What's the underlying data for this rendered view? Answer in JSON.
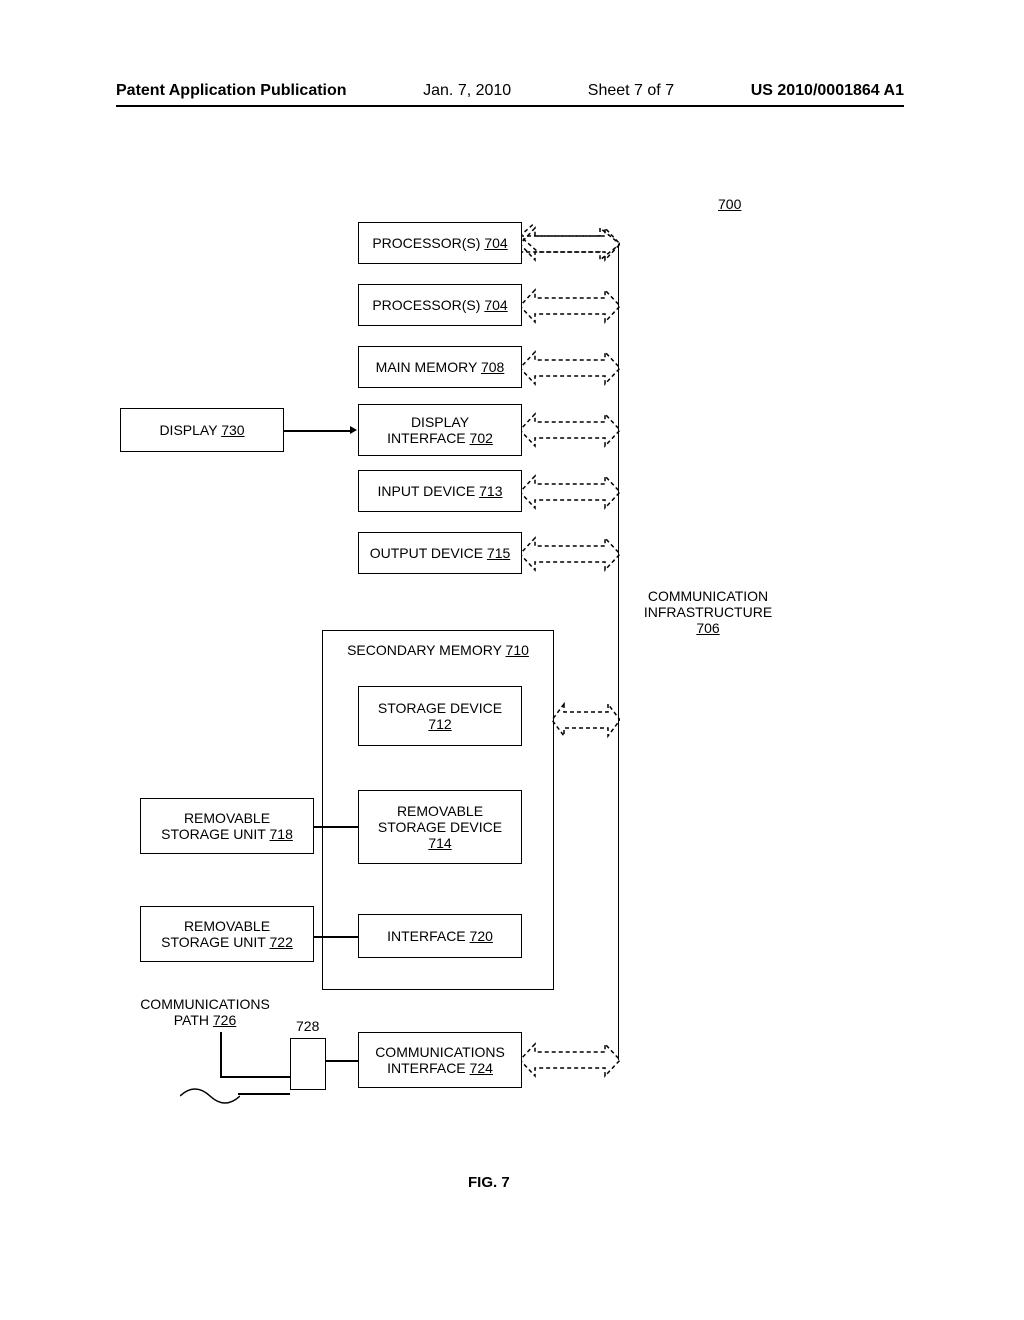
{
  "header": {
    "publication": "Patent Application Publication",
    "date": "Jan. 7, 2010",
    "sheet": "Sheet 7 of 7",
    "docnum": "US 2010/0001864 A1"
  },
  "figure": {
    "ref700": "700",
    "processor1": "PROCESSOR(S)",
    "processor1_ref": "704",
    "processor2": "PROCESSOR(S)",
    "processor2_ref": "704",
    "main_memory": "MAIN MEMORY",
    "main_memory_ref": "708",
    "display": "DISPLAY",
    "display_ref": "730",
    "display_iface": "DISPLAY INTERFACE",
    "display_iface_ref": "702",
    "input_device": "INPUT DEVICE",
    "input_device_ref": "713",
    "output_device": "OUTPUT DEVICE",
    "output_device_ref": "715",
    "comm_infra": "COMMUNICATION INFRASTRUCTURE",
    "comm_infra_ref": "706",
    "sec_memory": "SECONDARY MEMORY",
    "sec_memory_ref": "710",
    "storage": "STORAGE DEVICE",
    "storage_ref": "712",
    "remstorunit718": "REMOVABLE STORAGE UNIT",
    "remstorunit718_ref": "718",
    "remstor714": "REMOVABLE STORAGE DEVICE",
    "remstor714_ref": "714",
    "remstorunit722": "REMOVABLE STORAGE UNIT",
    "remstorunit722_ref": "722",
    "iface720": "INTERFACE",
    "iface720_ref": "720",
    "commpath": "COMMUNICATIONS PATH",
    "commpath_ref": "726",
    "ref728": "728",
    "commiface": "COMMUNICATIONS INTERFACE",
    "commiface_ref": "724",
    "figlabel": "FIG. 7"
  }
}
